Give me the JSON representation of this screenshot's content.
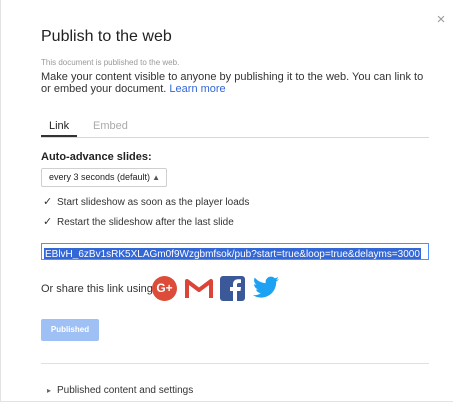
{
  "dialog": {
    "title": "Publish to the web",
    "close_glyph": "×",
    "status": "This document is published to the web.",
    "description": "Make your content visible to anyone by publishing it to the web. You can link to or embed your document.",
    "learn_more": "Learn more"
  },
  "tabs": [
    {
      "label": "Link",
      "active": true
    },
    {
      "label": "Embed",
      "active": false
    }
  ],
  "auto_advance": {
    "label": "Auto-advance slides:",
    "selected": "every 3 seconds (default)"
  },
  "options": [
    {
      "label": "Start slideshow as soon as the player loads",
      "checked": true
    },
    {
      "label": "Restart the slideshow after the last slide",
      "checked": true
    }
  ],
  "link_url": "EBlvH_6zBv1sRK5XLAGm0f9Wzgbmfsok/pub?start=true&loop=true&delayms=3000",
  "share": {
    "label": "Or share this link using:",
    "icons": [
      "google-plus-icon",
      "gmail-icon",
      "facebook-icon",
      "twitter-icon"
    ],
    "google_plus_text": "G+"
  },
  "publish_button": "Published",
  "footer": {
    "label": "Published content and settings",
    "caret": "▸"
  },
  "colors": {
    "link_blue": "#3367d6",
    "button_disabled_blue": "#9fc0f5",
    "google_plus_red": "#dd4b39",
    "gmail_red": "#db4437",
    "facebook_blue": "#3b5998",
    "twitter_blue": "#1da1f2"
  }
}
